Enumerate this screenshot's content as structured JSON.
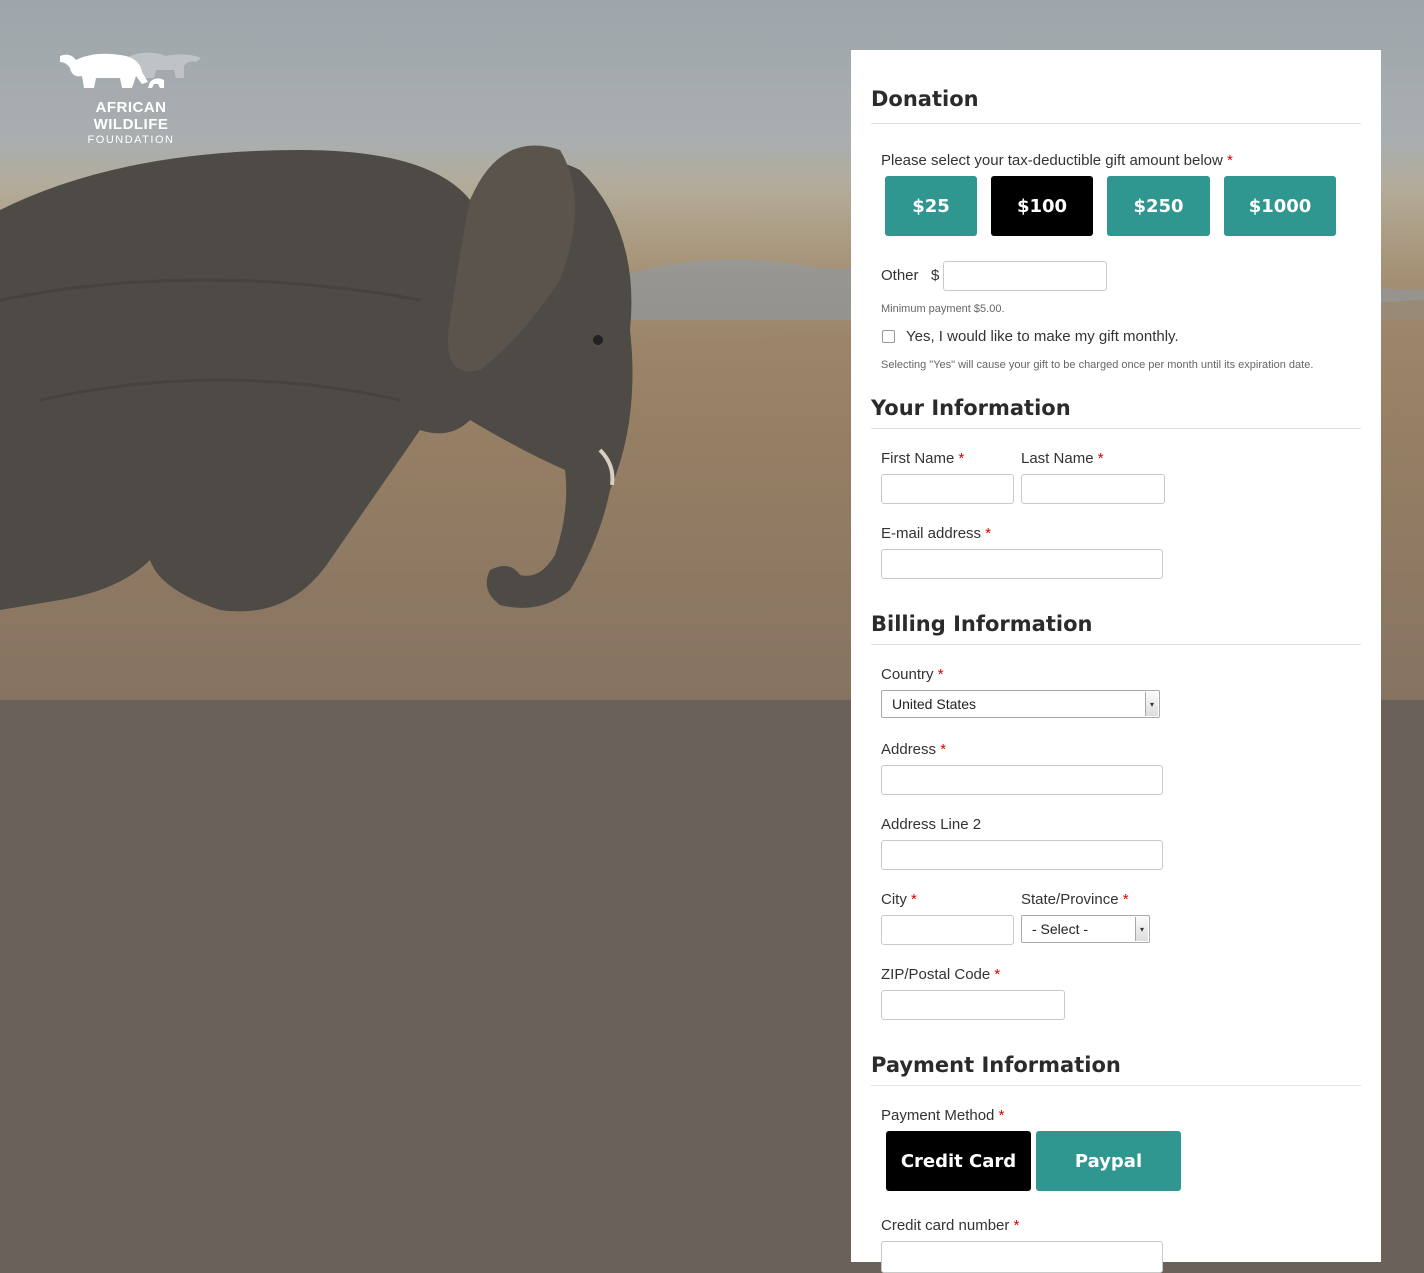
{
  "logo": {
    "line1": "AFRICAN WILDLIFE",
    "line2": "FOUNDATION"
  },
  "donation": {
    "heading": "Donation",
    "amount_label": "Please select your tax-deductible gift amount below",
    "amounts": [
      "$25",
      "$100",
      "$250",
      "$1000"
    ],
    "selected_amount": "$100",
    "other_label": "Other",
    "currency": "$",
    "other_value": "",
    "min_note": "Minimum payment $5.00.",
    "monthly_label": "Yes, I would like to make my gift monthly.",
    "monthly_checked": false,
    "monthly_note": "Selecting \"Yes\" will cause your gift to be charged once per month until its expiration date."
  },
  "your_info": {
    "heading": "Your Information",
    "first_name_label": "First Name",
    "last_name_label": "Last Name",
    "email_label": "E-mail address"
  },
  "billing": {
    "heading": "Billing Information",
    "country_label": "Country",
    "country_value": "United States",
    "address_label": "Address",
    "address2_label": "Address Line 2",
    "city_label": "City",
    "state_label": "State/Province",
    "state_value": "- Select -",
    "zip_label": "ZIP/Postal Code"
  },
  "payment": {
    "heading": "Payment Information",
    "method_label": "Payment Method",
    "methods": [
      "Credit Card",
      "Paypal"
    ],
    "selected_method": "Credit Card",
    "card_number_label": "Credit card number"
  },
  "required_marker": "*",
  "colors": {
    "accent": "#2f9690",
    "selected": "#000000",
    "required": "#dd0000"
  }
}
